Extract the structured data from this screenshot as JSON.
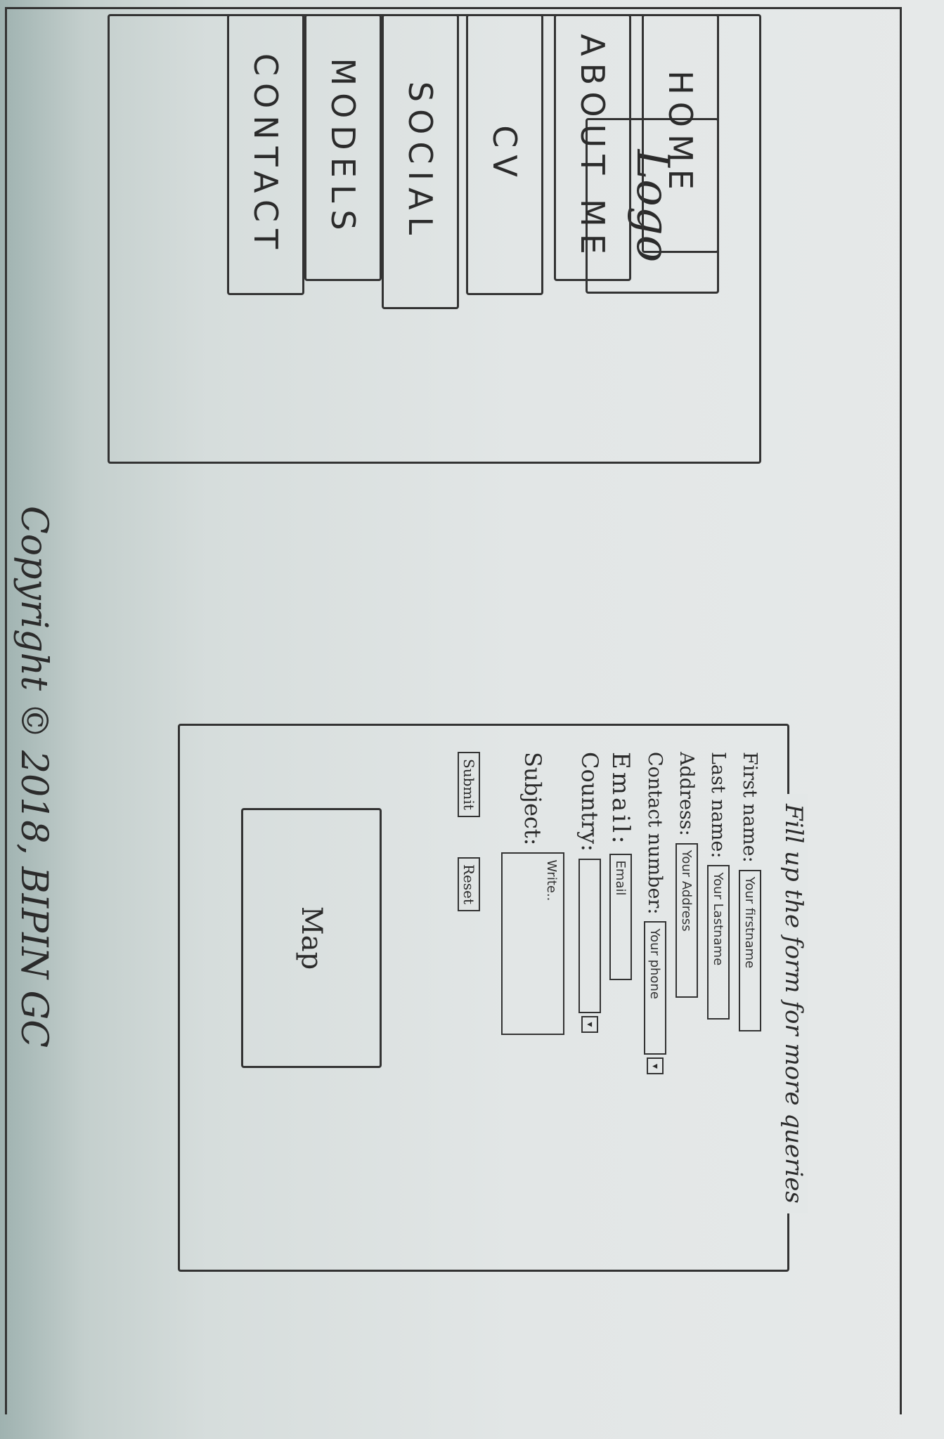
{
  "logo": {
    "label": "Logo"
  },
  "nav": {
    "items": [
      {
        "label": "HOME"
      },
      {
        "label": "ABOUT ME"
      },
      {
        "label": "CV"
      },
      {
        "label": "SOCIAL"
      },
      {
        "label": "MODELS"
      },
      {
        "label": "CONTACT"
      }
    ]
  },
  "form": {
    "legend": "Fill up the form for more queries",
    "fields": {
      "first_name": {
        "label": "First name:",
        "placeholder": "Your firstname"
      },
      "last_name": {
        "label": "Last name:",
        "placeholder": "Your Lastname"
      },
      "address": {
        "label": "Address:",
        "placeholder": "Your Address"
      },
      "contact": {
        "label": "Contact number:",
        "placeholder": "Your phone"
      },
      "email": {
        "label": "Email:",
        "placeholder": "Email"
      },
      "country": {
        "label": "Country:",
        "value": ""
      },
      "subject": {
        "label": "Subject:",
        "placeholder": "Write.."
      }
    },
    "submit_label": "Submit",
    "reset_label": "Reset"
  },
  "map": {
    "label": "Map"
  },
  "footer": {
    "copyright": "Copyright © 2018, BIPIN GC"
  }
}
